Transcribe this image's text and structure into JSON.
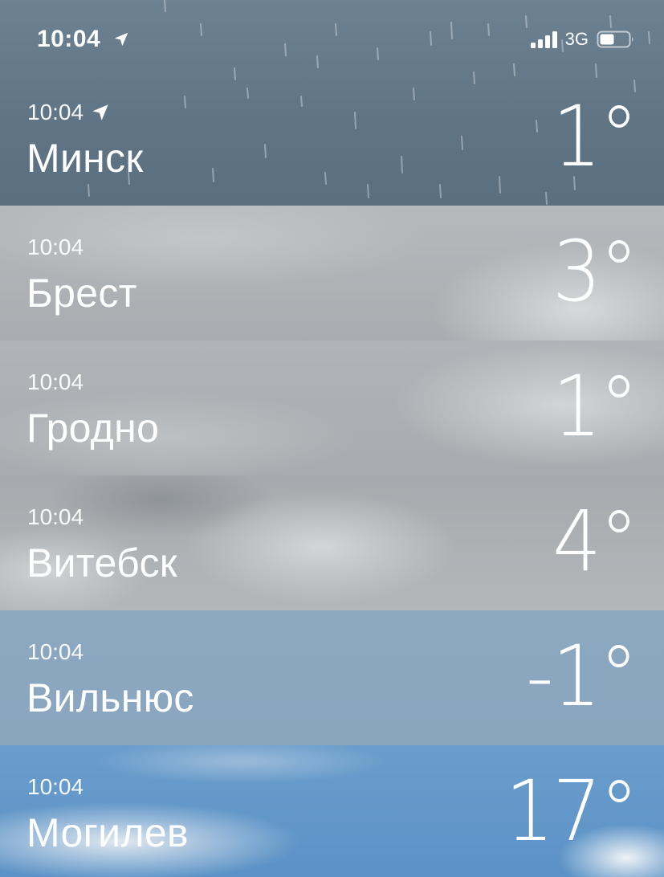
{
  "status_bar": {
    "time": "10:04",
    "network": "3G"
  },
  "cities": [
    {
      "time": "10:04",
      "name": "Минск",
      "temp": "1°",
      "has_location_icon": true,
      "condition": "rain"
    },
    {
      "time": "10:04",
      "name": "Брест",
      "temp": "3°",
      "has_location_icon": false,
      "condition": "cloudy"
    },
    {
      "time": "10:04",
      "name": "Гродно",
      "temp": "1°",
      "has_location_icon": false,
      "condition": "cloudy"
    },
    {
      "time": "10:04",
      "name": "Витебск",
      "temp": "4°",
      "has_location_icon": false,
      "condition": "cloudy"
    },
    {
      "time": "10:04",
      "name": "Вильнюс",
      "temp": "-1°",
      "has_location_icon": false,
      "condition": "overcast-blue"
    },
    {
      "time": "10:04",
      "name": "Могилев",
      "temp": "17°",
      "has_location_icon": false,
      "condition": "partly-cloudy"
    }
  ],
  "colors": {
    "rain_row": "#5f7485",
    "cloudy_row": "#b3b7ba",
    "blue_row": "#8da9c2",
    "sky_row": "#5d93c7"
  }
}
